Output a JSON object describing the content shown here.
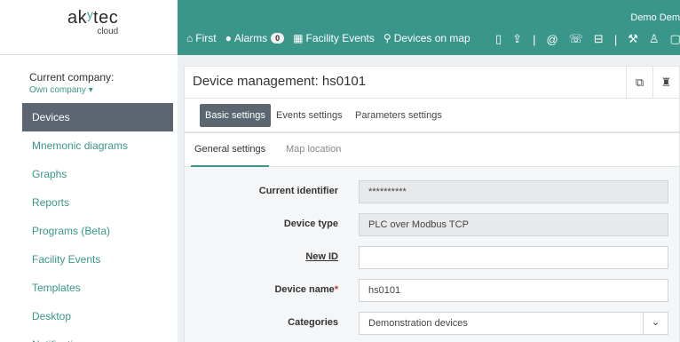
{
  "logo": {
    "brand": "ak",
    "brand_accent": "tec",
    "sub": "cloud"
  },
  "user": {
    "name": "Demo Dem"
  },
  "nav": [
    {
      "icon": "home-icon",
      "glyph": "⌂",
      "label": "First"
    },
    {
      "icon": "alert-icon",
      "glyph": "●",
      "label": "Alarms",
      "badge": "0"
    },
    {
      "icon": "events-icon",
      "glyph": "▦",
      "label": "Facility Events"
    },
    {
      "icon": "map-pin-icon",
      "glyph": "⚲",
      "label": "Devices on map"
    }
  ],
  "toolbar_icons": [
    "file-icon",
    "upload-icon",
    "separator",
    "at-icon",
    "phone-icon",
    "inbox-icon",
    "separator",
    "wrench-icon",
    "user-icon",
    "window-icon"
  ],
  "sidebar": {
    "company_label": "Current company:",
    "company_link": "Own company ▾",
    "items": [
      {
        "label": "Devices",
        "active": true
      },
      {
        "label": "Mnemonic diagrams"
      },
      {
        "label": "Graphs"
      },
      {
        "label": "Reports"
      },
      {
        "label": "Programs (Beta)"
      },
      {
        "label": "Facility Events"
      },
      {
        "label": "Templates"
      },
      {
        "label": "Desktop"
      },
      {
        "label": "Notifications"
      }
    ]
  },
  "main": {
    "title": "Device management: hs0101",
    "tabs": [
      "Basic settings",
      "Events settings",
      "Parameters settings"
    ],
    "subtabs": [
      "General settings",
      "Map location"
    ],
    "form": {
      "current_identifier_label": "Current identifier",
      "current_identifier_value": "**********",
      "device_type_label": "Device type",
      "device_type_value": "PLC over Modbus TCP",
      "new_id_label": "New ID",
      "new_id_value": "",
      "device_name_label": "Device name",
      "device_name_required": "*",
      "device_name_value": "hs0101",
      "categories_label": "Categories",
      "categories_value": "Demonstration devices"
    }
  },
  "colors": {
    "brand": "#3a968b",
    "active": "#5b6670"
  }
}
